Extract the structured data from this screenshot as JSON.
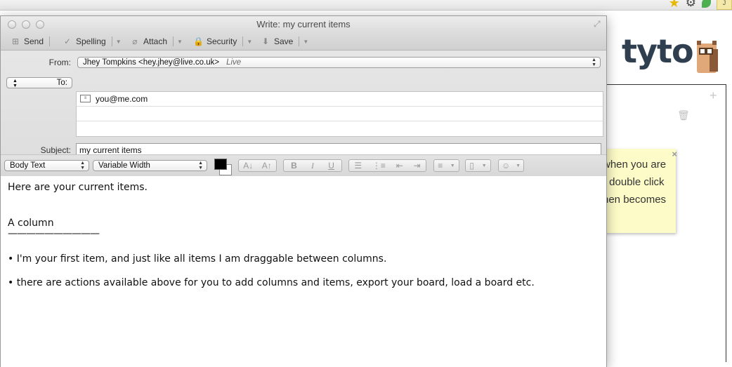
{
  "browser": {
    "icons": [
      "star-icon",
      "gear-icon",
      "leaf-icon",
      "user-icon"
    ],
    "user_badge": "J"
  },
  "app": {
    "logo": "tyto",
    "note_lines": [
      "when you are",
      "r double click",
      "hen becomes"
    ],
    "note_close": "×",
    "add_column": "+",
    "trash": "🗑"
  },
  "window": {
    "title": "Write: my current items",
    "toolbar": {
      "send": "Send",
      "spelling": "Spelling",
      "attach": "Attach",
      "security": "Security",
      "save": "Save"
    },
    "headers": {
      "from_label": "From:",
      "from_name": "Jhey Tompkins <hey.jhey@live.co.uk>",
      "from_account": "Live",
      "to_label": "To:",
      "to_value": "you@me.com",
      "subject_label": "Subject:",
      "subject_value": "my current items"
    },
    "format": {
      "paragraph_style": "Body Text",
      "font_width": "Variable Width",
      "text_color": "#000000",
      "background_color": "#ffffff"
    },
    "body": {
      "lines": [
        "Here are your current items.",
        "A column",
        "——————————",
        "• I'm your first item, and just like all items I am draggable between columns.",
        "• there are actions available above for you to add columns and items, export your board, load a board etc."
      ]
    }
  }
}
